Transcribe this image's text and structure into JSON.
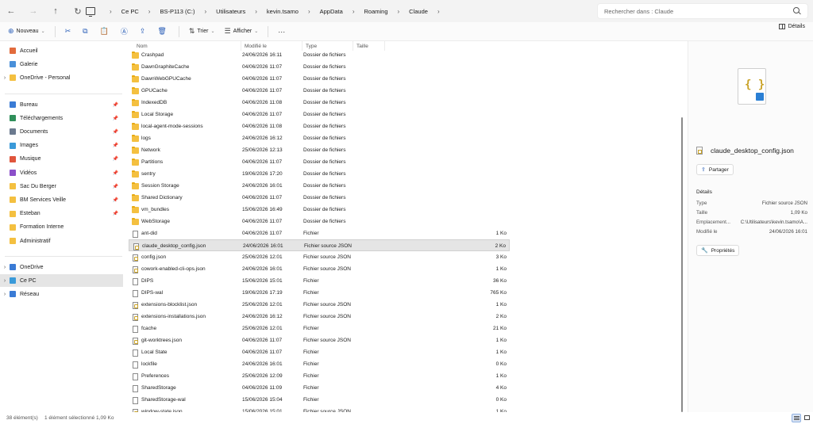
{
  "address_bar": {
    "crumbs": [
      "Ce PC",
      "BS-P113 (C:)",
      "Utilisateurs",
      "kevin.tsamo",
      "AppData",
      "Roaming",
      "Claude"
    ],
    "search_placeholder": "Rechercher dans : Claude"
  },
  "toolbar": {
    "new_label": "Nouveau",
    "sort_label": "Trier",
    "view_label": "Afficher",
    "more_label": "···",
    "details_label": "Détails"
  },
  "sidebar": {
    "quick": [
      {
        "label": "Accueil",
        "color": "#e26b3c"
      },
      {
        "label": "Galerie",
        "color": "#4a90d9"
      },
      {
        "label": "OneDrive - Personal",
        "color": "#f4c040"
      }
    ],
    "pinned": [
      {
        "label": "Bureau",
        "color": "#3a7bd5"
      },
      {
        "label": "Téléchargements",
        "color": "#2f8f5a"
      },
      {
        "label": "Documents",
        "color": "#6b7a8f"
      },
      {
        "label": "Images",
        "color": "#3a9ad9"
      },
      {
        "label": "Musique",
        "color": "#e0553c"
      },
      {
        "label": "Vidéos",
        "color": "#8b4fc9"
      },
      {
        "label": "Sac Du Berger",
        "color": "#f4c040"
      },
      {
        "label": "BM Services Veille",
        "color": "#f4c040"
      },
      {
        "label": "Esteban",
        "color": "#f4c040"
      },
      {
        "label": "Formation Interne",
        "color": "#f4c040"
      },
      {
        "label": "Administratif",
        "color": "#f4c040"
      }
    ],
    "drives": [
      {
        "label": "OneDrive",
        "color": "#3a7bd5"
      },
      {
        "label": "Ce PC",
        "color": "#3a9ad9"
      },
      {
        "label": "Réseau",
        "color": "#3a7bd5"
      }
    ]
  },
  "file_list": {
    "columns": {
      "name": "Nom",
      "modified": "Modifié le",
      "type": "Type",
      "size": "Taille"
    },
    "rows": [
      {
        "name": "Crashpad",
        "modified": "24/06/2026 16:11",
        "type": "Dossier de fichiers",
        "size": "",
        "kind": "folder"
      },
      {
        "name": "DawnGraphiteCache",
        "modified": "04/06/2026 11:07",
        "type": "Dossier de fichiers",
        "size": "",
        "kind": "folder"
      },
      {
        "name": "DawnWebGPUCache",
        "modified": "04/06/2026 11:07",
        "type": "Dossier de fichiers",
        "size": "",
        "kind": "folder"
      },
      {
        "name": "GPUCache",
        "modified": "04/06/2026 11:07",
        "type": "Dossier de fichiers",
        "size": "",
        "kind": "folder"
      },
      {
        "name": "IndexedDB",
        "modified": "04/06/2026 11:08",
        "type": "Dossier de fichiers",
        "size": "",
        "kind": "folder"
      },
      {
        "name": "Local Storage",
        "modified": "04/06/2026 11:07",
        "type": "Dossier de fichiers",
        "size": "",
        "kind": "folder"
      },
      {
        "name": "local-agent-mode-sessions",
        "modified": "04/06/2026 11:08",
        "type": "Dossier de fichiers",
        "size": "",
        "kind": "folder"
      },
      {
        "name": "logs",
        "modified": "24/06/2026 16:12",
        "type": "Dossier de fichiers",
        "size": "",
        "kind": "folder"
      },
      {
        "name": "Network",
        "modified": "25/06/2026 12:13",
        "type": "Dossier de fichiers",
        "size": "",
        "kind": "folder"
      },
      {
        "name": "Partitions",
        "modified": "04/06/2026 11:07",
        "type": "Dossier de fichiers",
        "size": "",
        "kind": "folder"
      },
      {
        "name": "sentry",
        "modified": "19/06/2026 17:20",
        "type": "Dossier de fichiers",
        "size": "",
        "kind": "folder"
      },
      {
        "name": "Session Storage",
        "modified": "24/06/2026 16:01",
        "type": "Dossier de fichiers",
        "size": "",
        "kind": "folder"
      },
      {
        "name": "Shared Dictionary",
        "modified": "04/06/2026 11:07",
        "type": "Dossier de fichiers",
        "size": "",
        "kind": "folder"
      },
      {
        "name": "vm_bundles",
        "modified": "15/06/2026 16:49",
        "type": "Dossier de fichiers",
        "size": "",
        "kind": "folder"
      },
      {
        "name": "WebStorage",
        "modified": "04/06/2026 11:07",
        "type": "Dossier de fichiers",
        "size": "",
        "kind": "folder"
      },
      {
        "name": "ant-did",
        "modified": "04/06/2026 11:07",
        "type": "Fichier",
        "size": "1 Ko",
        "kind": "file"
      },
      {
        "name": "claude_desktop_config.json",
        "modified": "24/06/2026 16:01",
        "type": "Fichier source JSON",
        "size": "2 Ko",
        "kind": "json",
        "selected": true
      },
      {
        "name": "config.json",
        "modified": "25/06/2026 12:01",
        "type": "Fichier source JSON",
        "size": "3 Ko",
        "kind": "json"
      },
      {
        "name": "cowork-enabled-cli-ops.json",
        "modified": "24/06/2026 16:01",
        "type": "Fichier source JSON",
        "size": "1 Ko",
        "kind": "json"
      },
      {
        "name": "DIPS",
        "modified": "15/06/2026 15:01",
        "type": "Fichier",
        "size": "36 Ko",
        "kind": "file"
      },
      {
        "name": "DIPS-wal",
        "modified": "19/06/2026 17:19",
        "type": "Fichier",
        "size": "765 Ko",
        "kind": "file"
      },
      {
        "name": "extensions-blocklist.json",
        "modified": "25/06/2026 12:01",
        "type": "Fichier source JSON",
        "size": "1 Ko",
        "kind": "json"
      },
      {
        "name": "extensions-installations.json",
        "modified": "24/06/2026 16:12",
        "type": "Fichier source JSON",
        "size": "2 Ko",
        "kind": "json"
      },
      {
        "name": "fcache",
        "modified": "25/06/2026 12:01",
        "type": "Fichier",
        "size": "21 Ko",
        "kind": "file"
      },
      {
        "name": "git-worktrees.json",
        "modified": "04/06/2026 11:07",
        "type": "Fichier source JSON",
        "size": "1 Ko",
        "kind": "json"
      },
      {
        "name": "Local State",
        "modified": "04/06/2026 11:07",
        "type": "Fichier",
        "size": "1 Ko",
        "kind": "file"
      },
      {
        "name": "lockfile",
        "modified": "24/06/2026 16:01",
        "type": "Fichier",
        "size": "0 Ko",
        "kind": "file"
      },
      {
        "name": "Preferences",
        "modified": "25/06/2026 12:09",
        "type": "Fichier",
        "size": "1 Ko",
        "kind": "file"
      },
      {
        "name": "SharedStorage",
        "modified": "04/06/2026 11:09",
        "type": "Fichier",
        "size": "4 Ko",
        "kind": "file"
      },
      {
        "name": "SharedStorage-wal",
        "modified": "15/06/2026 15:04",
        "type": "Fichier",
        "size": "0 Ko",
        "kind": "file"
      },
      {
        "name": "window-state.json",
        "modified": "15/06/2026 15:01",
        "type": "Fichier source JSON",
        "size": "1 Ko",
        "kind": "json"
      }
    ]
  },
  "details_pane": {
    "file_name": "claude_desktop_config.json",
    "share_label": "Partager",
    "section_title": "Détails",
    "properties": [
      {
        "key": "Type",
        "value": "Fichier source JSON"
      },
      {
        "key": "Taille",
        "value": "1,09 Ko"
      },
      {
        "key": "Emplacement...",
        "value": "C:\\Utilisateurs\\kevin.tsamo\\A..."
      },
      {
        "key": "Modifié le",
        "value": "24/06/2026 16:01"
      }
    ],
    "properties_label": "Propriétés"
  },
  "status_bar": {
    "count": "38 élément(s)",
    "selection": "1 élément sélectionné  1,09 Ko"
  }
}
